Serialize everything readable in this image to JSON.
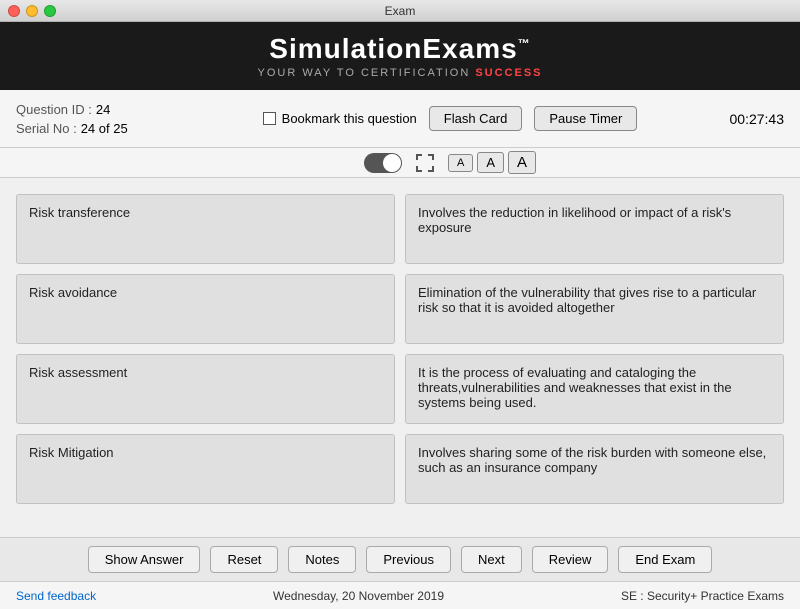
{
  "titleBar": {
    "title": "Exam"
  },
  "brandBar": {
    "name": "SimulationExams",
    "tm": "™",
    "tagline": "YOUR WAY TO CERTIFICATION ",
    "taglineHighlight": "SUCCESS"
  },
  "infoBar": {
    "questionLabel": "Question ID :",
    "questionValue": "24",
    "serialLabel": "Serial No :",
    "serialValue": "24 of 25",
    "bookmarkLabel": "Bookmark this question",
    "flashCardLabel": "Flash Card",
    "pauseTimerLabel": "Pause Timer",
    "timer": "00:27:43"
  },
  "cards": [
    {
      "term": "Risk transference",
      "definition": "Involves the reduction in likelihood or impact of a risk's exposure"
    },
    {
      "term": "Risk avoidance",
      "definition": "Elimination of the vulnerability that gives rise to a particular risk so that it is avoided altogether"
    },
    {
      "term": "Risk assessment",
      "definition": "It is the process of evaluating and cataloging the threats,vulnerabilities and weaknesses that exist in the systems being used."
    },
    {
      "term": "Risk Mitigation",
      "definition": "Involves sharing some of the risk burden with someone else, such as an insurance company"
    }
  ],
  "bottomButtons": {
    "showAnswer": "Show Answer",
    "reset": "Reset",
    "notes": "Notes",
    "previous": "Previous",
    "next": "Next",
    "review": "Review",
    "endExam": "End Exam"
  },
  "statusBar": {
    "feedback": "Send feedback",
    "date": "Wednesday, 20 November 2019",
    "examInfo": "SE : Security+ Practice Exams"
  },
  "fontSizes": [
    "A",
    "A",
    "A"
  ]
}
